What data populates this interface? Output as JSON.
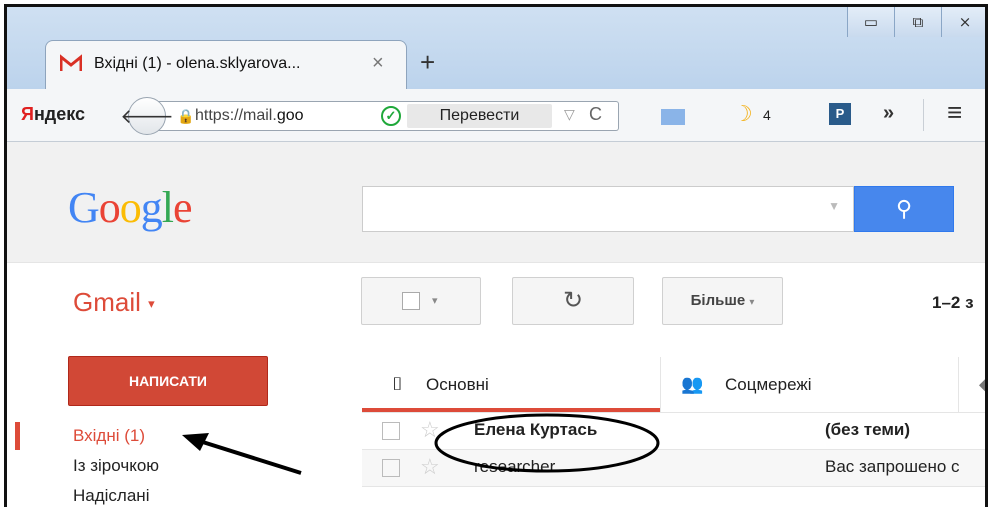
{
  "browser": {
    "tab_title": "Вхідні (1) - olena.sklyarova...",
    "tab_close": "×",
    "new_tab": "+",
    "window_controls": [
      "▭",
      "⧉",
      "⨯"
    ],
    "brand_prefix": "Я",
    "brand_rest": "ндекс",
    "back_icon": "🡐",
    "lock_icon": "🔒",
    "url_scheme": "https://mail.",
    "url_host": "goo",
    "check_icon": "✓",
    "translate_label": "Перевести",
    "url_dropdown": "▽",
    "reload_icon": "C",
    "moon_icon": "☽",
    "moon_count": "4",
    "p_icon": "P",
    "more_icon": "»",
    "menu_icon": "≡"
  },
  "google": {
    "logo_letters": [
      "G",
      "o",
      "o",
      "g",
      "l",
      "e"
    ],
    "search_value": "",
    "search_dropdown": "▼",
    "search_icon": "⚲"
  },
  "gmail": {
    "label": "Gmail",
    "caret": "▾",
    "select_dropdown": "▾",
    "refresh_icon": "↻",
    "more_label": "Більше",
    "more_dropdown": "▾",
    "pager": "1–2 з",
    "compose_label": "НАПИСАТИ",
    "sidebar": [
      {
        "label": "Вхідні (1)",
        "active": true
      },
      {
        "label": "Із зірочкою",
        "active": false
      },
      {
        "label": "Надіслані",
        "active": false
      }
    ],
    "tabs": [
      {
        "label": "Основні",
        "icon": "inbox-icon",
        "glyph": "⌷"
      },
      {
        "label": "Соцмережі",
        "icon": "people-icon",
        "glyph": "👥"
      },
      {
        "label": "",
        "icon": "tag-icon",
        "glyph": "◆"
      }
    ],
    "messages": [
      {
        "sender": "Елена Куртась",
        "subject": "(без теми)",
        "unread": true,
        "star": "☆"
      },
      {
        "sender": "researcher",
        "subject": "Вас запрошено с",
        "unread": false,
        "star": "☆"
      }
    ]
  },
  "colors": {
    "gmail_red": "#dd4b39",
    "compose_red": "#d14836",
    "search_blue": "#4787ed"
  }
}
